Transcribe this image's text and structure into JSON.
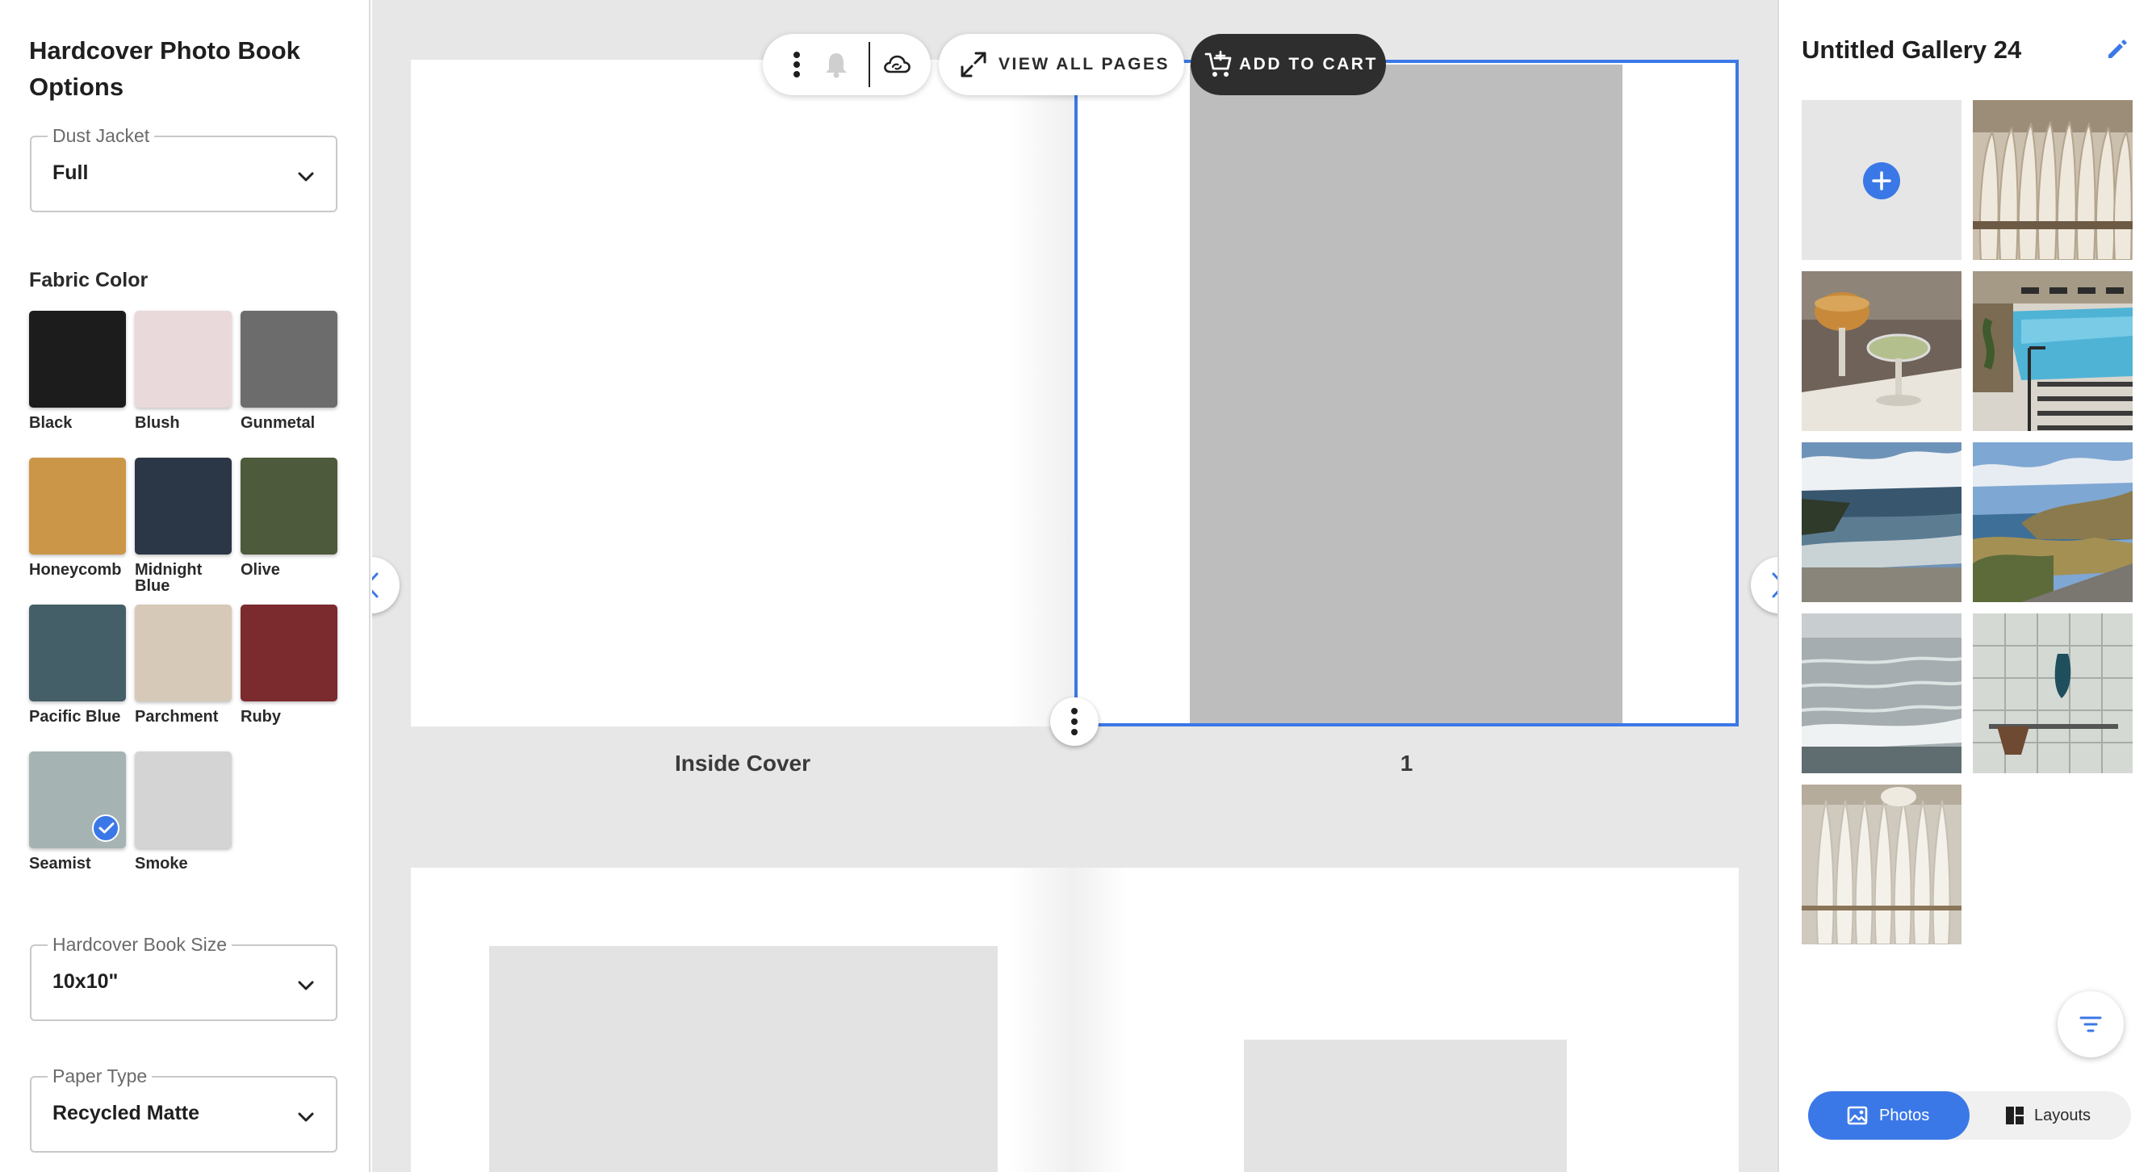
{
  "options": {
    "title": "Hardcover Photo Book Options",
    "dust_jacket": {
      "legend": "Dust Jacket",
      "value": "Full"
    },
    "fabric_color_label": "Fabric Color",
    "fabric_colors": [
      {
        "name": "Black",
        "color": "#1c1c1c",
        "selected": false
      },
      {
        "name": "Blush",
        "color": "#ead9da",
        "selected": false
      },
      {
        "name": "Gunmetal",
        "color": "#6b6c6b",
        "selected": false
      },
      {
        "name": "Honeycomb",
        "color": "#cc9648",
        "selected": false
      },
      {
        "name": "Midnight Blue",
        "color": "#2b3646",
        "selected": false
      },
      {
        "name": "Olive",
        "color": "#4d5a3b",
        "selected": false
      },
      {
        "name": "Pacific Blue",
        "color": "#455f69",
        "selected": false
      },
      {
        "name": "Parchment",
        "color": "#d7c9b8",
        "selected": false
      },
      {
        "name": "Ruby",
        "color": "#7b2a2d",
        "selected": false
      },
      {
        "name": "Seamist",
        "color": "#a6b3b3",
        "selected": true
      },
      {
        "name": "Smoke",
        "color": "#d4d4d4",
        "selected": false
      }
    ],
    "book_size": {
      "legend": "Hardcover Book Size",
      "value": "10x10\""
    },
    "paper_type": {
      "legend": "Paper Type",
      "value": "Recycled Matte"
    }
  },
  "toolbar": {
    "more_icon": "more-vertical-icon",
    "notification_icon": "bell-icon",
    "cloud_icon": "cloud-sync-icon",
    "view_all_label": "VIEW ALL PAGES",
    "add_to_cart_label": "ADD TO CART"
  },
  "spread": {
    "left_page_label": "Inside Cover",
    "right_page_label": "1"
  },
  "gallery": {
    "title": "Untitled Gallery 24",
    "tiles": [
      {
        "type": "add",
        "icon": "plus-icon"
      },
      {
        "type": "photo",
        "subject": "surfboards-rack"
      },
      {
        "type": "photo",
        "subject": "cocktails-table"
      },
      {
        "type": "photo",
        "subject": "pool"
      },
      {
        "type": "photo",
        "subject": "beach-shore"
      },
      {
        "type": "photo",
        "subject": "coastal-cliffs"
      },
      {
        "type": "photo",
        "subject": "ocean-waves"
      },
      {
        "type": "photo",
        "subject": "bathroom-tiles"
      },
      {
        "type": "photo",
        "subject": "surfboards-wall"
      }
    ],
    "tabs": {
      "photos_label": "Photos",
      "layouts_label": "Layouts"
    }
  },
  "colors": {
    "accent": "#3b78e7",
    "dark": "#2e2e2e"
  }
}
